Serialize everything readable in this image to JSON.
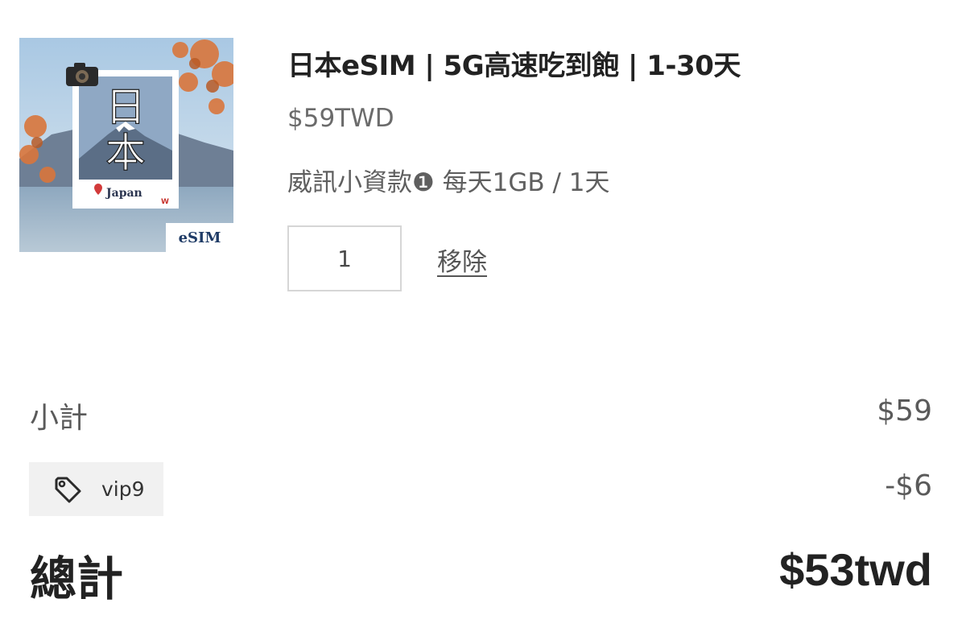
{
  "product": {
    "image": {
      "alt_icon": "japan-esim-card-image",
      "big_text": "日本",
      "location_text": "Japan",
      "badge_text": "eSIM"
    },
    "title": "日本eSIM | 5G高速吃到飽 | 1-30天",
    "price": "$59TWD",
    "variant": "威訊小資款❶ 每天1GB / 1天",
    "quantity": "1",
    "remove_label": "移除"
  },
  "summary": {
    "subtotal_label": "小計",
    "subtotal_value": "$59",
    "discount_code": "vip9",
    "discount_icon": "tag-icon",
    "discount_value": "-$6",
    "total_label": "總計",
    "total_value": "$53twd"
  },
  "colors": {
    "title_text": "#222222",
    "muted_text": "#5a5a5a",
    "chip_bg": "#f1f1f1",
    "qty_border": "#d6d6d6"
  }
}
